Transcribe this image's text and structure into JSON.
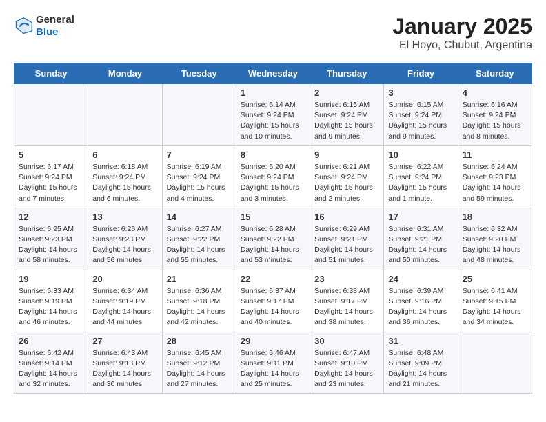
{
  "header": {
    "logo_general": "General",
    "logo_blue": "Blue",
    "title": "January 2025",
    "subtitle": "El Hoyo, Chubut, Argentina"
  },
  "weekdays": [
    "Sunday",
    "Monday",
    "Tuesday",
    "Wednesday",
    "Thursday",
    "Friday",
    "Saturday"
  ],
  "weeks": [
    [
      {
        "day": "",
        "info": ""
      },
      {
        "day": "",
        "info": ""
      },
      {
        "day": "",
        "info": ""
      },
      {
        "day": "1",
        "info": "Sunrise: 6:14 AM\nSunset: 9:24 PM\nDaylight: 15 hours\nand 10 minutes."
      },
      {
        "day": "2",
        "info": "Sunrise: 6:15 AM\nSunset: 9:24 PM\nDaylight: 15 hours\nand 9 minutes."
      },
      {
        "day": "3",
        "info": "Sunrise: 6:15 AM\nSunset: 9:24 PM\nDaylight: 15 hours\nand 9 minutes."
      },
      {
        "day": "4",
        "info": "Sunrise: 6:16 AM\nSunset: 9:24 PM\nDaylight: 15 hours\nand 8 minutes."
      }
    ],
    [
      {
        "day": "5",
        "info": "Sunrise: 6:17 AM\nSunset: 9:24 PM\nDaylight: 15 hours\nand 7 minutes."
      },
      {
        "day": "6",
        "info": "Sunrise: 6:18 AM\nSunset: 9:24 PM\nDaylight: 15 hours\nand 6 minutes."
      },
      {
        "day": "7",
        "info": "Sunrise: 6:19 AM\nSunset: 9:24 PM\nDaylight: 15 hours\nand 4 minutes."
      },
      {
        "day": "8",
        "info": "Sunrise: 6:20 AM\nSunset: 9:24 PM\nDaylight: 15 hours\nand 3 minutes."
      },
      {
        "day": "9",
        "info": "Sunrise: 6:21 AM\nSunset: 9:24 PM\nDaylight: 15 hours\nand 2 minutes."
      },
      {
        "day": "10",
        "info": "Sunrise: 6:22 AM\nSunset: 9:24 PM\nDaylight: 15 hours\nand 1 minute."
      },
      {
        "day": "11",
        "info": "Sunrise: 6:24 AM\nSunset: 9:23 PM\nDaylight: 14 hours\nand 59 minutes."
      }
    ],
    [
      {
        "day": "12",
        "info": "Sunrise: 6:25 AM\nSunset: 9:23 PM\nDaylight: 14 hours\nand 58 minutes."
      },
      {
        "day": "13",
        "info": "Sunrise: 6:26 AM\nSunset: 9:23 PM\nDaylight: 14 hours\nand 56 minutes."
      },
      {
        "day": "14",
        "info": "Sunrise: 6:27 AM\nSunset: 9:22 PM\nDaylight: 14 hours\nand 55 minutes."
      },
      {
        "day": "15",
        "info": "Sunrise: 6:28 AM\nSunset: 9:22 PM\nDaylight: 14 hours\nand 53 minutes."
      },
      {
        "day": "16",
        "info": "Sunrise: 6:29 AM\nSunset: 9:21 PM\nDaylight: 14 hours\nand 51 minutes."
      },
      {
        "day": "17",
        "info": "Sunrise: 6:31 AM\nSunset: 9:21 PM\nDaylight: 14 hours\nand 50 minutes."
      },
      {
        "day": "18",
        "info": "Sunrise: 6:32 AM\nSunset: 9:20 PM\nDaylight: 14 hours\nand 48 minutes."
      }
    ],
    [
      {
        "day": "19",
        "info": "Sunrise: 6:33 AM\nSunset: 9:19 PM\nDaylight: 14 hours\nand 46 minutes."
      },
      {
        "day": "20",
        "info": "Sunrise: 6:34 AM\nSunset: 9:19 PM\nDaylight: 14 hours\nand 44 minutes."
      },
      {
        "day": "21",
        "info": "Sunrise: 6:36 AM\nSunset: 9:18 PM\nDaylight: 14 hours\nand 42 minutes."
      },
      {
        "day": "22",
        "info": "Sunrise: 6:37 AM\nSunset: 9:17 PM\nDaylight: 14 hours\nand 40 minutes."
      },
      {
        "day": "23",
        "info": "Sunrise: 6:38 AM\nSunset: 9:17 PM\nDaylight: 14 hours\nand 38 minutes."
      },
      {
        "day": "24",
        "info": "Sunrise: 6:39 AM\nSunset: 9:16 PM\nDaylight: 14 hours\nand 36 minutes."
      },
      {
        "day": "25",
        "info": "Sunrise: 6:41 AM\nSunset: 9:15 PM\nDaylight: 14 hours\nand 34 minutes."
      }
    ],
    [
      {
        "day": "26",
        "info": "Sunrise: 6:42 AM\nSunset: 9:14 PM\nDaylight: 14 hours\nand 32 minutes."
      },
      {
        "day": "27",
        "info": "Sunrise: 6:43 AM\nSunset: 9:13 PM\nDaylight: 14 hours\nand 30 minutes."
      },
      {
        "day": "28",
        "info": "Sunrise: 6:45 AM\nSunset: 9:12 PM\nDaylight: 14 hours\nand 27 minutes."
      },
      {
        "day": "29",
        "info": "Sunrise: 6:46 AM\nSunset: 9:11 PM\nDaylight: 14 hours\nand 25 minutes."
      },
      {
        "day": "30",
        "info": "Sunrise: 6:47 AM\nSunset: 9:10 PM\nDaylight: 14 hours\nand 23 minutes."
      },
      {
        "day": "31",
        "info": "Sunrise: 6:48 AM\nSunset: 9:09 PM\nDaylight: 14 hours\nand 21 minutes."
      },
      {
        "day": "",
        "info": ""
      }
    ]
  ]
}
